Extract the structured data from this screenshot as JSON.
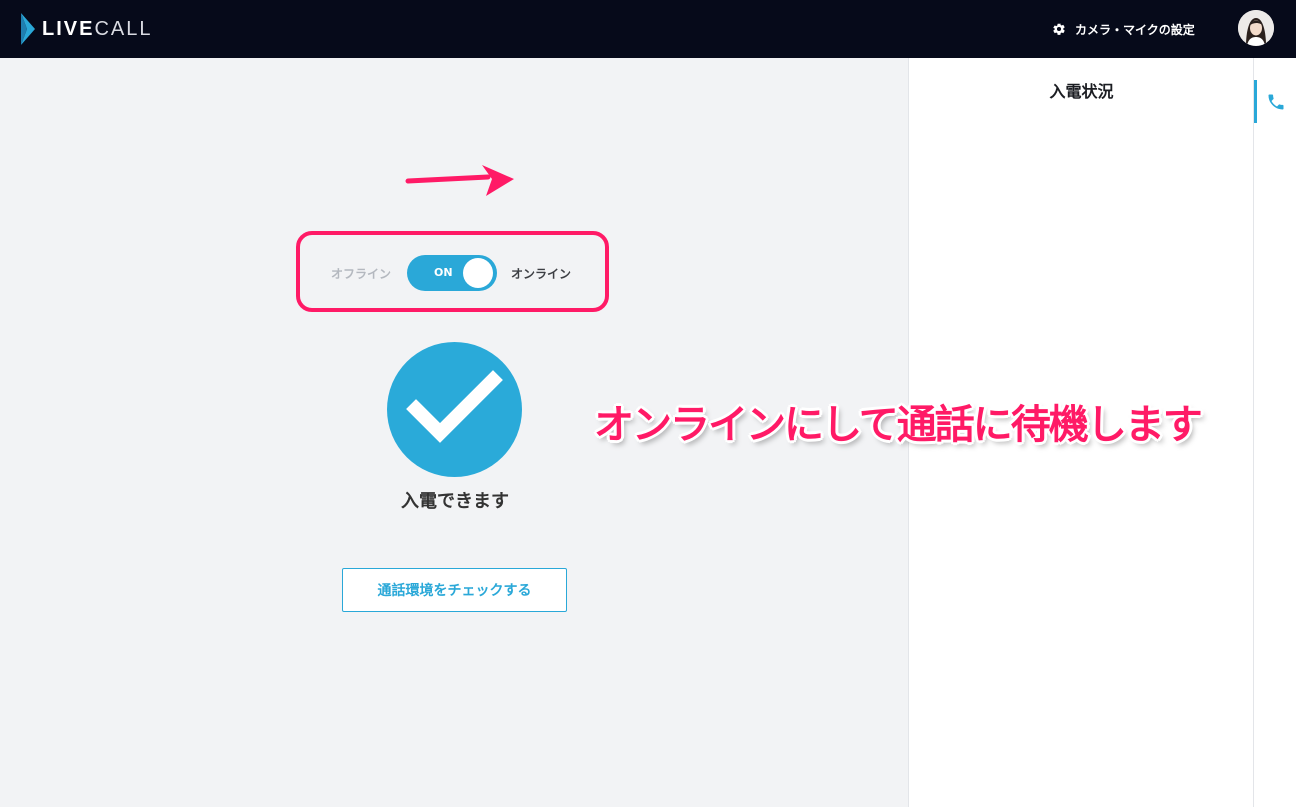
{
  "header": {
    "logo_live": "LIVE",
    "logo_call": "CALL",
    "settings_label": "カメラ・マイクの設定",
    "settings_icon": "gear-icon",
    "avatar_icon": "user-avatar"
  },
  "status_toggle": {
    "offline_label": "オフライン",
    "toggle_text": "ON",
    "online_label": "オンライン",
    "state": "on"
  },
  "status": {
    "icon": "checkmark-icon",
    "text": "入電できます"
  },
  "check_button": {
    "label": "通話環境をチェックする"
  },
  "incoming_panel": {
    "title": "入電状況",
    "tab_icon": "phone-icon"
  },
  "annotation": {
    "caption": "オンラインにして通話に待機します",
    "arrow_icon": "arrow-icon"
  },
  "colors": {
    "header_bg": "#060a1a",
    "accent": "#2aa8d8",
    "highlight": "#ff1a66",
    "page_bg": "#f2f3f5"
  }
}
